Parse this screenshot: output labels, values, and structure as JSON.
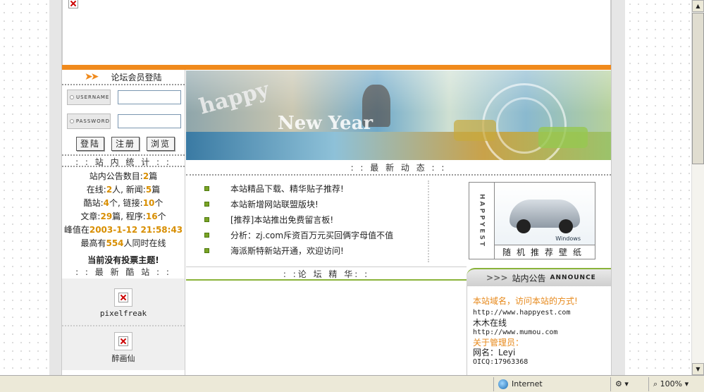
{
  "login": {
    "title": "论坛会员登陆",
    "username_label": "USERNAME",
    "password_label": "PASSWORD",
    "buttons": [
      "登陆",
      "注册",
      "浏览"
    ]
  },
  "stats": {
    "title": ": : 站 内 统 计 : :",
    "lines": [
      {
        "pre": "站内公告数目:",
        "n1": "2",
        "mid": "篇",
        "n2": "",
        "post": ""
      },
      {
        "pre": "在线:",
        "n1": "2",
        "mid": "人, 新闻:",
        "n2": "5",
        "post": "篇"
      },
      {
        "pre": "酷站:",
        "n1": "4",
        "mid": "个, 链接:",
        "n2": "10",
        "post": "个"
      },
      {
        "pre": "文章:",
        "n1": "29",
        "mid": "篇, 程序:",
        "n2": "16",
        "post": "个"
      },
      {
        "pre": "峰值在",
        "n1": "2003-1-12 21:58:43",
        "mid": "",
        "n2": "",
        "post": ""
      },
      {
        "pre": "最高有",
        "n1": "554",
        "mid": "人同时在线",
        "n2": "",
        "post": ""
      }
    ],
    "no_vote": "当前没有投票主题!"
  },
  "cool": {
    "title": ": : 最 新 酷 站 : :",
    "sites": [
      "pixelfreak",
      "醉画仙"
    ]
  },
  "hero": {
    "word1": "happy",
    "word2": "New Year"
  },
  "news": {
    "title": ": : 最 新 动 态 : :",
    "items": [
      "本站精品下载、精华贴子推荐!",
      "本站新增网站联盟版块!",
      "[推荐]本站推出免费留言板!",
      "分析：zj.com斥资百万元买回俩字母值不值",
      "海派斯特新站开通，欢迎访问!"
    ]
  },
  "wallpaper": {
    "brand": "HAPPYEST",
    "caption": "随机推荐壁纸",
    "logo": "Windows"
  },
  "jinghua": {
    "title": ": :论 坛 精 华: :"
  },
  "notice": {
    "title": "站内公告",
    "en": "ANNOUNCE",
    "chev": "> > >",
    "lines": [
      {
        "t": "本站域名，访问本站的方式!",
        "cls": "o"
      },
      {
        "t": "http://www.happyest.com",
        "cls": "mono"
      },
      {
        "t": "木木在线",
        "cls": ""
      },
      {
        "t": "http://www.mumou.com",
        "cls": "mono"
      },
      {
        "t": "关于管理员：",
        "cls": "o"
      },
      {
        "t": "网名：Leyi",
        "cls": ""
      },
      {
        "t": "OICQ:17963368",
        "cls": "mono"
      }
    ]
  },
  "statusbar": {
    "zone": "Internet",
    "zoom": "100%"
  }
}
